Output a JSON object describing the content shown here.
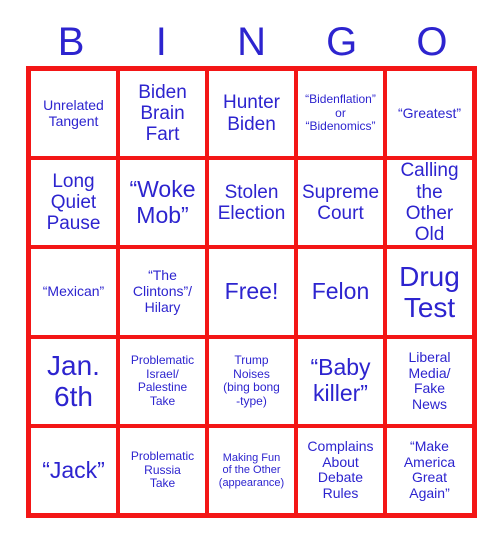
{
  "card": {
    "title_letters": [
      "B",
      "I",
      "N",
      "G",
      "O"
    ],
    "colors": {
      "text_blue": "#2d24cf",
      "grid_red": "#f31616",
      "cell_background": "#ffffff",
      "page_background": "#ffffff"
    },
    "rows": [
      [
        {
          "text": "Unrelated\nTangent",
          "size": "sm",
          "name": "cell-b1"
        },
        {
          "text": "Biden\nBrain\nFart",
          "size": "md",
          "name": "cell-i1"
        },
        {
          "text": "Hunter\nBiden",
          "size": "md",
          "name": "cell-n1"
        },
        {
          "text": "“Bidenflation”\nor\n“Bidenomics”",
          "size": "xs",
          "name": "cell-g1"
        },
        {
          "text": "“Greatest”",
          "size": "sm",
          "name": "cell-o1"
        }
      ],
      [
        {
          "text": "Long\nQuiet\nPause",
          "size": "md",
          "name": "cell-b2"
        },
        {
          "text": "“Woke\nMob”",
          "size": "lg",
          "name": "cell-i2"
        },
        {
          "text": "Stolen\nElection",
          "size": "md",
          "name": "cell-n2"
        },
        {
          "text": "Supreme\nCourt",
          "size": "md",
          "name": "cell-g2"
        },
        {
          "text": "Calling\nthe Other\nOld",
          "size": "md",
          "name": "cell-o2"
        }
      ],
      [
        {
          "text": "“Mexican”",
          "size": "sm",
          "name": "cell-b3"
        },
        {
          "text": "“The\nClintons”/\nHilary",
          "size": "sm",
          "name": "cell-i3"
        },
        {
          "text": "Free!",
          "size": "lg",
          "name": "cell-n3-free"
        },
        {
          "text": "Felon",
          "size": "lg",
          "name": "cell-g3"
        },
        {
          "text": "Drug\nTest",
          "size": "xl",
          "name": "cell-o3"
        }
      ],
      [
        {
          "text": "Jan.\n6th",
          "size": "xl",
          "name": "cell-b4"
        },
        {
          "text": "Problematic\nIsrael/\nPalestine\nTake",
          "size": "xs",
          "name": "cell-i4"
        },
        {
          "text": "Trump\nNoises\n(bing bong\n-type)",
          "size": "xs",
          "name": "cell-n4"
        },
        {
          "text": "“Baby\nkiller”",
          "size": "lg",
          "name": "cell-g4"
        },
        {
          "text": "Liberal\nMedia/\nFake\nNews",
          "size": "sm",
          "name": "cell-o4"
        }
      ],
      [
        {
          "text": "“Jack”",
          "size": "lg",
          "name": "cell-b5"
        },
        {
          "text": "Problematic\nRussia\nTake",
          "size": "xs",
          "name": "cell-i5"
        },
        {
          "text": "Making Fun\nof the Other\n(appearance)",
          "size": "xxs",
          "name": "cell-n5"
        },
        {
          "text": "Complains\nAbout\nDebate\nRules",
          "size": "sm",
          "name": "cell-g5"
        },
        {
          "text": "“Make\nAmerica\nGreat\nAgain”",
          "size": "sm",
          "name": "cell-o5"
        }
      ]
    ]
  }
}
